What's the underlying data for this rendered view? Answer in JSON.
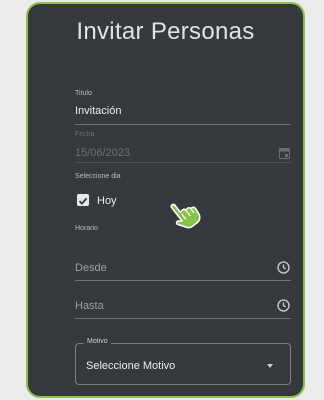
{
  "dialog": {
    "title": "Invitar Personas",
    "titulo": {
      "label": "Titulo",
      "value": "Invitación"
    },
    "fecha": {
      "label": "Fecha",
      "value": "15/06/2023"
    },
    "seleccione_dia": {
      "label": "Seleccione dia",
      "checkbox_label": "Hoy",
      "checked": true
    },
    "horario": {
      "label": "Horario"
    },
    "desde": {
      "placeholder": "Desde"
    },
    "hasta": {
      "placeholder": "Hasta"
    },
    "motivo": {
      "legend": "Motivo",
      "value": "Seleccione Motivo"
    }
  },
  "colors": {
    "accent": "#8bc34a",
    "panel": "#35383d",
    "page": "#ececec"
  }
}
